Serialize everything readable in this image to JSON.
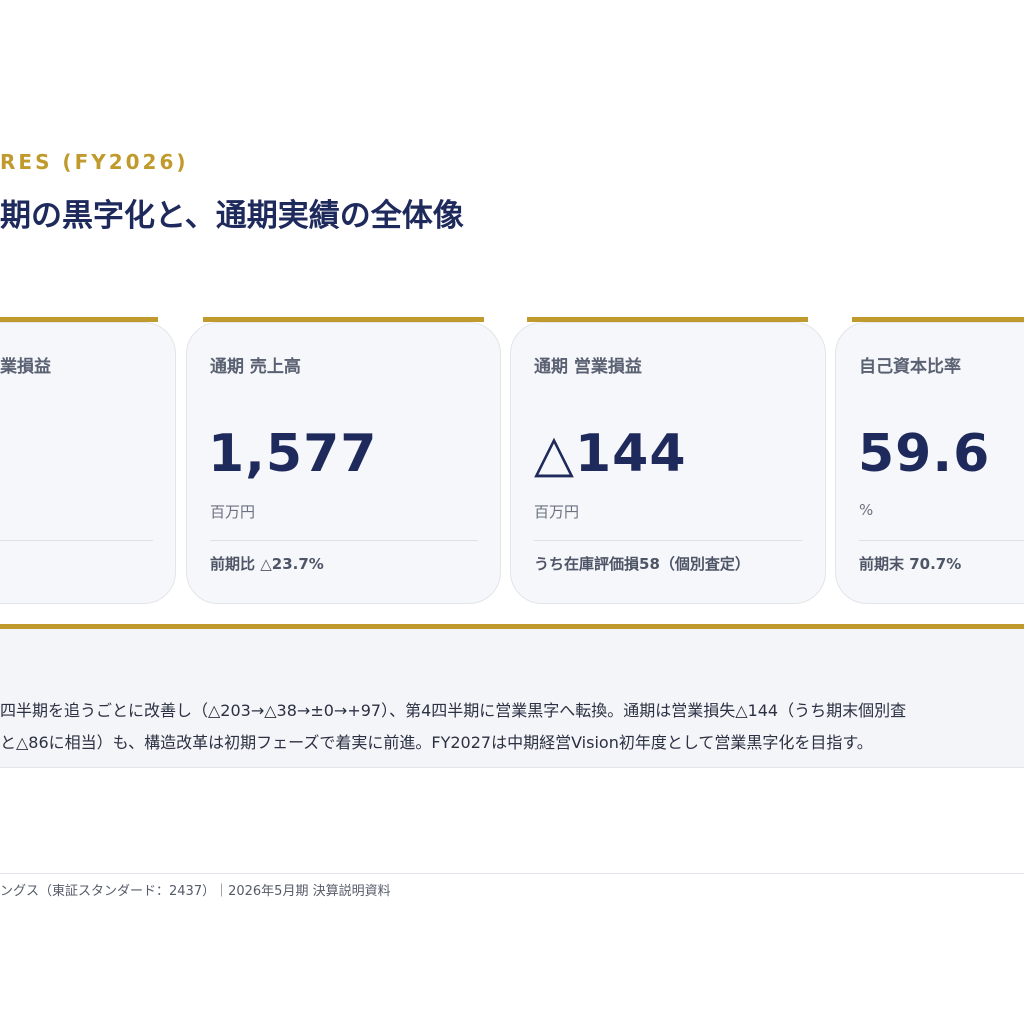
{
  "header": {
    "eyebrow": "RES (FY2026)",
    "title": "期の黒字化と、通期実績の全体像"
  },
  "cards": [
    {
      "label": "業損益",
      "value": "",
      "unit": "",
      "note": ""
    },
    {
      "label": "通期 売上高",
      "value": "1,577",
      "unit": "百万円",
      "note": "前期比 △23.7%"
    },
    {
      "label": "通期 営業損益",
      "value": "△144",
      "unit": "百万円",
      "note": "うち在庫評価損58（個別査定）"
    },
    {
      "label": "自己資本比率",
      "value": "59.6",
      "unit": "%",
      "note": "前期末 70.7%"
    }
  ],
  "summary": {
    "line1": "四半期を追うごとに改善し（△203→△38→±0→+97）、第4四半期に営業黒字へ転換。通期は営業損失△144（うち期末個別査",
    "line2": "と△86に相当）も、構造改革は初期フェーズで着実に前進。FY2027は中期経営Vision初年度として営業黒字化を目指す。"
  },
  "footer": {
    "text": "ングス（東証スタンダード：2437）｜2026年5月期 決算説明資料"
  },
  "colors": {
    "accent_gold": "#c19a2e",
    "navy": "#1f2a5c",
    "card_bg": "#f6f7fa"
  }
}
